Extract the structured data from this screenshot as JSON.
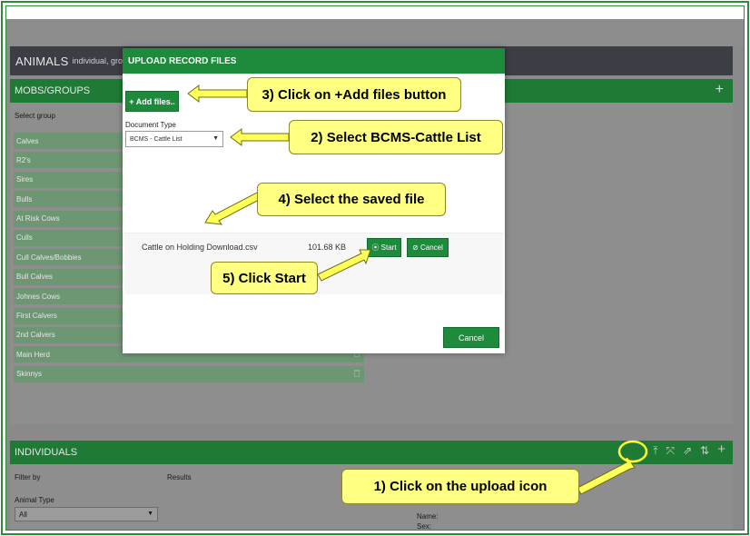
{
  "animals": {
    "title": "ANIMALS",
    "subtitle": "individual, group & b"
  },
  "mobs": {
    "header": "MOBS/GROUPS",
    "add_icon": "plus-icon",
    "select_label": "Select group",
    "groups": [
      "Calves",
      "R2's",
      "Sires",
      "Bulls",
      "At Risk Cows",
      "Culls",
      "Cull Calves/Bobbies",
      "Bull Calves",
      "Johnes Cows",
      "First Calvers",
      "2nd Calvers",
      "Main Herd",
      "Skinnys"
    ]
  },
  "individuals": {
    "header": "INDIVIDUALS",
    "filter_label": "Filter by",
    "results_label": "Results",
    "animal_type_label": "Animal Type",
    "animal_type_value": "All",
    "name_label": "Name:",
    "sex_label": "Sex:",
    "icons": [
      "upload-icon",
      "move-icon",
      "transfer-icon",
      "sort-icon",
      "plus-icon"
    ]
  },
  "modal": {
    "title": "UPLOAD RECORD FILES",
    "add_files": "+ Add files..",
    "doc_type_label": "Document Type",
    "doc_type_value": "BCMS - Cattle List",
    "file": {
      "name": "Cattle on Holding Download.csv",
      "size": "101.68 KB"
    },
    "start": "⦿ Start",
    "cancel_file": "⊘ Cancel",
    "cancel": "Cancel"
  },
  "callouts": {
    "step1": "1) Click on the upload icon",
    "step2": "2) Select BCMS-Cattle List",
    "step3": "3) Click on +Add files button",
    "step4": "4) Select the saved file",
    "step5": "5) Click Start"
  },
  "colors": {
    "green": "#1e8a3c",
    "callout": "#ffff82",
    "dark_bar": "#3b3e45"
  }
}
